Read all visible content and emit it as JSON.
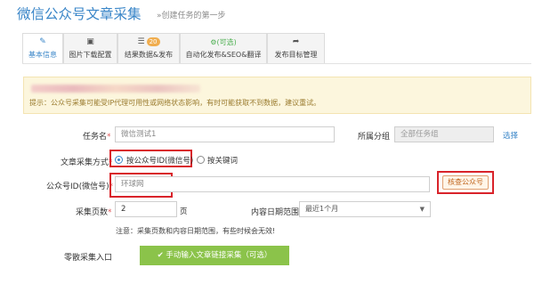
{
  "header": {
    "title": "微信公众号文章采集",
    "subtitle": "»创建任务的第一步"
  },
  "tabs": [
    {
      "label": "基本信息",
      "icon": "edit-icon",
      "glyph": "✎",
      "active": true
    },
    {
      "label": "图片下载配置",
      "icon": "image-icon",
      "glyph": "▣",
      "active": false
    },
    {
      "label": "结果数据&发布",
      "icon": "database-icon",
      "glyph": "☰",
      "badge": "20",
      "active": false
    },
    {
      "label": "自动化发布&SEO&翻译",
      "icon": "gears-icon",
      "glyph": "⚙",
      "badge_text": "(可选)",
      "active": false
    },
    {
      "label": "发布目标管理",
      "icon": "share-icon",
      "glyph": "➦",
      "active": false
    }
  ],
  "notice": {
    "tip": "提示：公众号采集可能受IP代理可用性或网络状态影响，有时可能获取不到数据，建议重试。"
  },
  "form": {
    "task_name": {
      "label": "任务名",
      "value": "微信测试1"
    },
    "group": {
      "label": "所属分组",
      "value": "全部任务组",
      "link": "选择"
    },
    "method": {
      "label": "文章采集方式",
      "options": [
        {
          "label": "按公众号ID(微信号)",
          "selected": true
        },
        {
          "label": "按关键词",
          "selected": false
        }
      ]
    },
    "account_id": {
      "label": "公众号ID(微信号)",
      "value": "环球网",
      "check_button": "核查公众号"
    },
    "pages": {
      "label": "采集页数",
      "value": "2",
      "unit": "页"
    },
    "date_range": {
      "label": "内容日期范围",
      "value": "最近1个月"
    },
    "note": "注意：采集页数和内容日期范围，有些时候会无效!",
    "manual": {
      "label": "零散采集入口",
      "button": "✔ 手动输入文章链接采集（可选）"
    }
  },
  "colors": {
    "accent": "#3a86c8",
    "highlight": "#d9232a",
    "green": "#8bc34a",
    "notice_bg": "#fcf6dd"
  }
}
